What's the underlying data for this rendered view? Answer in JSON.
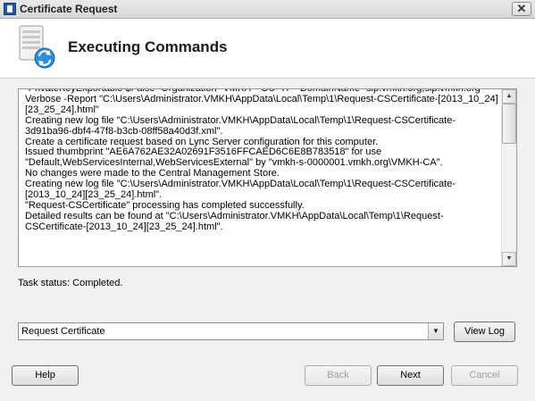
{
  "window": {
    "title": "Certificate Request",
    "close_glyph": "✕"
  },
  "header": {
    "title": "Executing Commands"
  },
  "log": {
    "text": "-PrivateKeyExportable $False -Organization \"VMKH\" -OU \"IT\" -DomainName \"sip.vmkh.org,sip.vmkh.org\" -Verbose -Report \"C:\\Users\\Administrator.VMKH\\AppData\\Local\\Temp\\1\\Request-CSCertificate-[2013_10_24][23_25_24].html\"\nCreating new log file \"C:\\Users\\Administrator.VMKH\\AppData\\Local\\Temp\\1\\Request-CSCertificate-3d91ba96-dbf4-47f8-b3cb-08ff58a40d3f.xml\".\nCreate a certificate request based on Lync Server configuration for this computer.\nIssued thumbprint \"AE6A762AE32A02691F3516FFCAED6C6E8B783518\" for use \"Default,WebServicesInternal,WebServicesExternal\" by \"vmkh-s-0000001.vmkh.org\\VMKH-CA\".\nNo changes were made to the Central Management Store.\nCreating new log file \"C:\\Users\\Administrator.VMKH\\AppData\\Local\\Temp\\1\\Request-CSCertificate-[2013_10_24][23_25_24].html\".\n\"Request-CSCertificate\" processing has completed successfully.\nDetailed results can be found at \"C:\\Users\\Administrator.VMKH\\AppData\\Local\\Temp\\1\\Request-CSCertificate-[2013_10_24][23_25_24].html\"."
  },
  "status": {
    "text": "Task status: Completed."
  },
  "combo": {
    "value": "Request Certificate",
    "arrow_glyph": "▼"
  },
  "buttons": {
    "view_log": "View Log",
    "help": "Help",
    "back": "Back",
    "next": "Next",
    "cancel": "Cancel"
  },
  "scrollbar": {
    "up_glyph": "▲",
    "down_glyph": "▼"
  },
  "icons": {
    "app": "certificate-app-icon",
    "header": "server-sync-icon"
  }
}
